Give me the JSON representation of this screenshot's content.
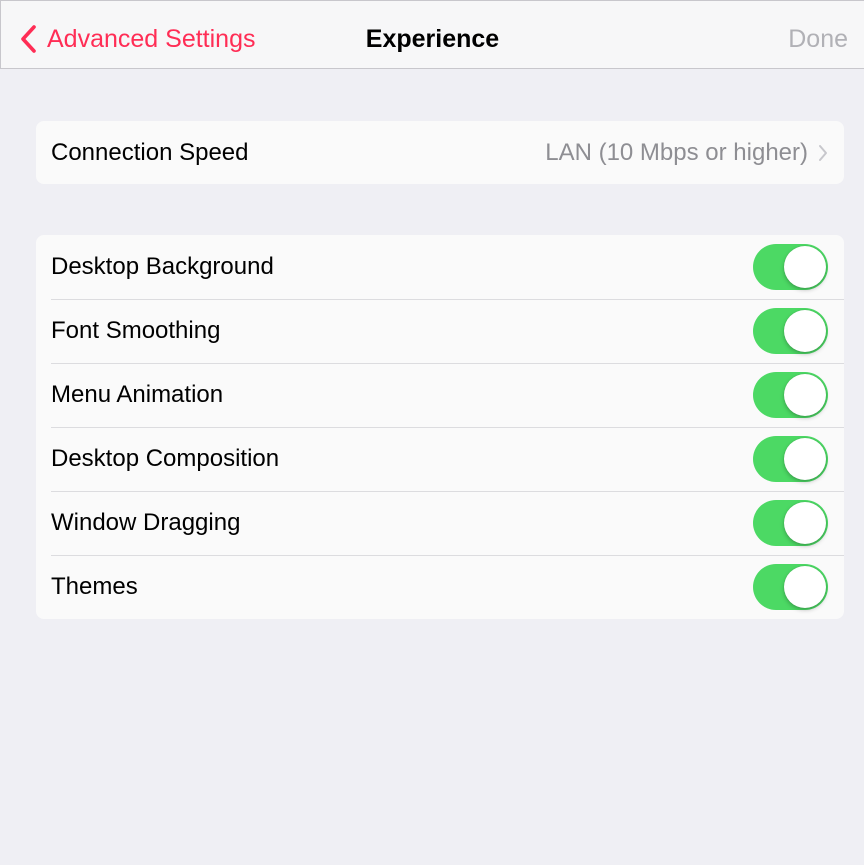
{
  "nav": {
    "back_label": "Advanced Settings",
    "title": "Experience",
    "done_label": "Done",
    "back_icon": "chevron-left-icon"
  },
  "connection": {
    "label": "Connection Speed",
    "value": "LAN (10 Mbps or higher)",
    "disclosure_icon": "chevron-right-icon"
  },
  "toggles": [
    {
      "label": "Desktop Background",
      "on": true
    },
    {
      "label": "Font Smoothing",
      "on": true
    },
    {
      "label": "Menu Animation",
      "on": true
    },
    {
      "label": "Desktop Composition",
      "on": true
    },
    {
      "label": "Window Dragging",
      "on": true
    },
    {
      "label": "Themes",
      "on": true
    }
  ],
  "colors": {
    "accent": "#ff2d55",
    "switch_on": "#4cd964",
    "background": "#efeff4",
    "secondary_text": "#8e8e93",
    "disabled_text": "#b1b1b6"
  }
}
